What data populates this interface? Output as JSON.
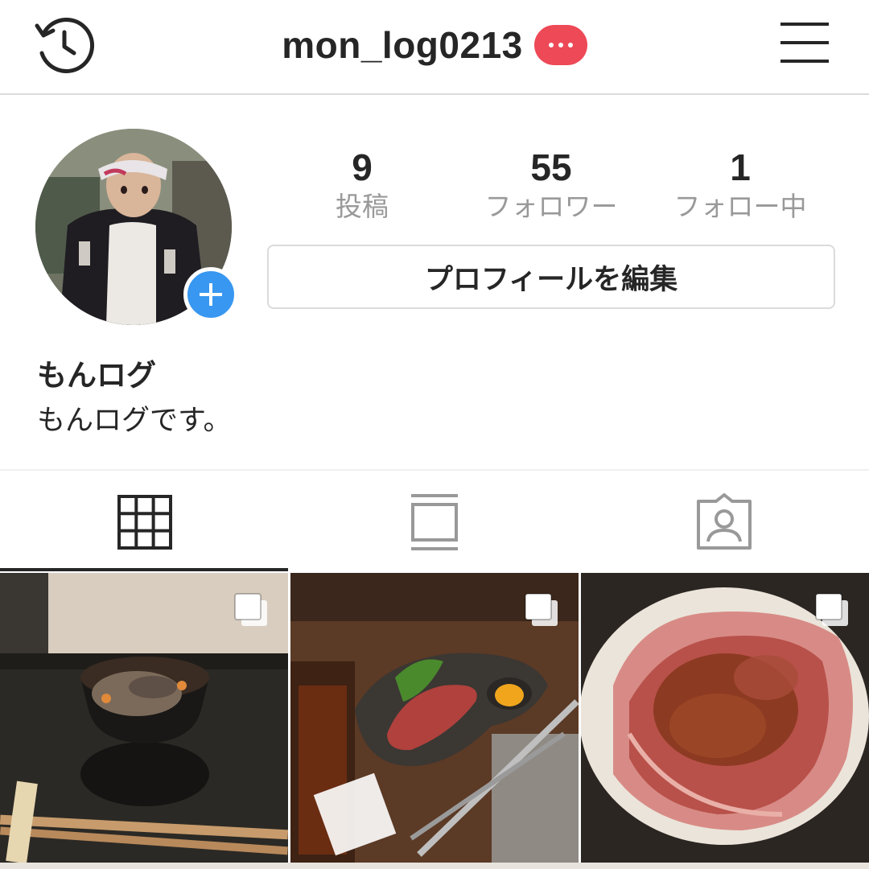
{
  "header": {
    "username": "mon_log0213",
    "notification_icon": "more-dots-icon",
    "notification_color": "#ed4956",
    "left_icon": "history-icon",
    "right_icon": "hamburger-menu-icon"
  },
  "profile": {
    "avatar_icon": "profile-photo",
    "add_story_icon": "plus-icon",
    "add_story_color": "#3897f0",
    "stats": [
      {
        "value": "9",
        "label": "投稿"
      },
      {
        "value": "55",
        "label": "フォロワー"
      },
      {
        "value": "1",
        "label": "フォロー中"
      }
    ],
    "edit_profile_label": "プロフィールを編集",
    "display_name": "もんログ",
    "bio": "もんログです。"
  },
  "tabs": [
    {
      "icon": "grid-icon",
      "active": true
    },
    {
      "icon": "feed-icon",
      "active": false
    },
    {
      "icon": "tagged-icon",
      "active": false
    }
  ],
  "posts": [
    {
      "subject": "truffle rice bowl",
      "multi_icon": "carousel-icon"
    },
    {
      "subject": "wagyu beef plate",
      "multi_icon": "carousel-icon"
    },
    {
      "subject": "sliced wagyu sukiyaki",
      "multi_icon": "carousel-icon"
    }
  ]
}
